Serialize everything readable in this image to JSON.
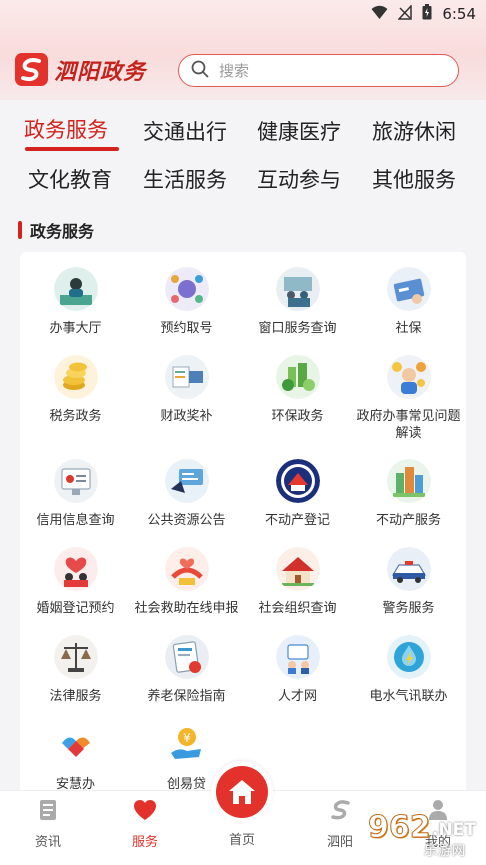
{
  "status": {
    "time": "6:54"
  },
  "header": {
    "app_name": "泗阳政务",
    "search_placeholder": "搜索"
  },
  "categories": {
    "row1": [
      "政务服务",
      "交通出行",
      "健康医疗",
      "旅游休闲"
    ],
    "row2": [
      "文化教育",
      "生活服务",
      "互动参与",
      "其他服务"
    ],
    "active": "政务服务"
  },
  "section": {
    "title": "政务服务"
  },
  "services": [
    {
      "label": "办事大厅",
      "icon": "office-hall-icon"
    },
    {
      "label": "预约取号",
      "icon": "queue-number-icon"
    },
    {
      "label": "窗口服务查询",
      "icon": "window-service-icon"
    },
    {
      "label": "社保",
      "icon": "social-security-card-icon"
    },
    {
      "label": "税务政务",
      "icon": "tax-coins-icon"
    },
    {
      "label": "财政奖补",
      "icon": "finance-subsidy-icon"
    },
    {
      "label": "环保政务",
      "icon": "environment-icon"
    },
    {
      "label": "政府办事常见问题解读",
      "icon": "faq-icon"
    },
    {
      "label": "信用信息查询",
      "icon": "credit-info-icon"
    },
    {
      "label": "公共资源公告",
      "icon": "public-resource-icon"
    },
    {
      "label": "不动产登记",
      "icon": "real-estate-seal-icon"
    },
    {
      "label": "不动产服务",
      "icon": "real-estate-buildings-icon"
    },
    {
      "label": "婚姻登记预约",
      "icon": "marriage-registration-icon"
    },
    {
      "label": "社会救助在线申报",
      "icon": "social-aid-icon"
    },
    {
      "label": "社会组织查询",
      "icon": "social-organization-icon"
    },
    {
      "label": "警务服务",
      "icon": "police-car-icon"
    },
    {
      "label": "法律服务",
      "icon": "law-scale-icon"
    },
    {
      "label": "养老保险指南",
      "icon": "pension-insurance-icon"
    },
    {
      "label": "人才网",
      "icon": "talent-network-icon"
    },
    {
      "label": "电水气讯联办",
      "icon": "utilities-icon"
    },
    {
      "label": "安慧办",
      "icon": "anhui-ban-icon"
    },
    {
      "label": "创易贷",
      "icon": "loan-icon"
    }
  ],
  "tabbar": {
    "items": [
      {
        "label": "资讯",
        "icon": "news-icon"
      },
      {
        "label": "服务",
        "icon": "heart-icon"
      },
      {
        "label": "首页",
        "icon": "home-icon"
      },
      {
        "label": "泗阳",
        "icon": "siyang-logo-icon"
      },
      {
        "label": "我的",
        "icon": "user-icon"
      }
    ],
    "active": "服务"
  },
  "watermark": {
    "main": "962",
    "suffix": ".NET",
    "sub": "乐游网"
  },
  "colors": {
    "accent": "#e2322b",
    "background": "#f4f4f6",
    "card": "#ffffff"
  }
}
